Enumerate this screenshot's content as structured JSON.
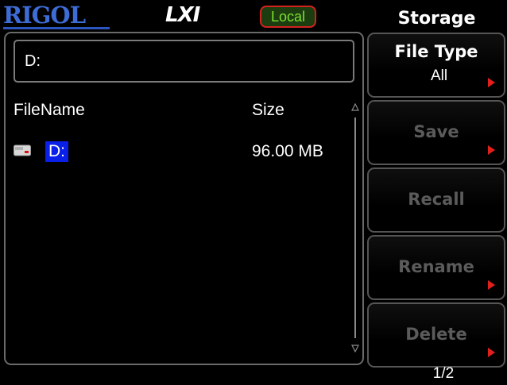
{
  "header": {
    "brand": "RIGOL",
    "lxi_logo": "LXI",
    "status_badge": "Local",
    "menu_title": "Storage"
  },
  "colors": {
    "brand_blue": "#3e6cd6",
    "badge_border": "#d2231f",
    "badge_text": "#7ee032",
    "selection": "#0a1fe8",
    "arrow_red": "#e1201c",
    "disabled_text": "#5b5b5b"
  },
  "browser": {
    "path": "D:",
    "columns": {
      "name": "FileName",
      "size": "Size"
    },
    "rows": [
      {
        "icon": "drive-icon",
        "name": "D:",
        "size": "96.00 MB",
        "selected": true
      }
    ]
  },
  "softkeys": [
    {
      "label": "File Type",
      "value": "All",
      "has_submenu": true,
      "enabled": true
    },
    {
      "label": "Save",
      "has_submenu": true,
      "enabled": false
    },
    {
      "label": "Recall",
      "has_submenu": false,
      "enabled": false
    },
    {
      "label": "Rename",
      "has_submenu": true,
      "enabled": false
    },
    {
      "label": "Delete",
      "has_submenu": true,
      "enabled": false
    }
  ],
  "page_indicator": "1/2"
}
